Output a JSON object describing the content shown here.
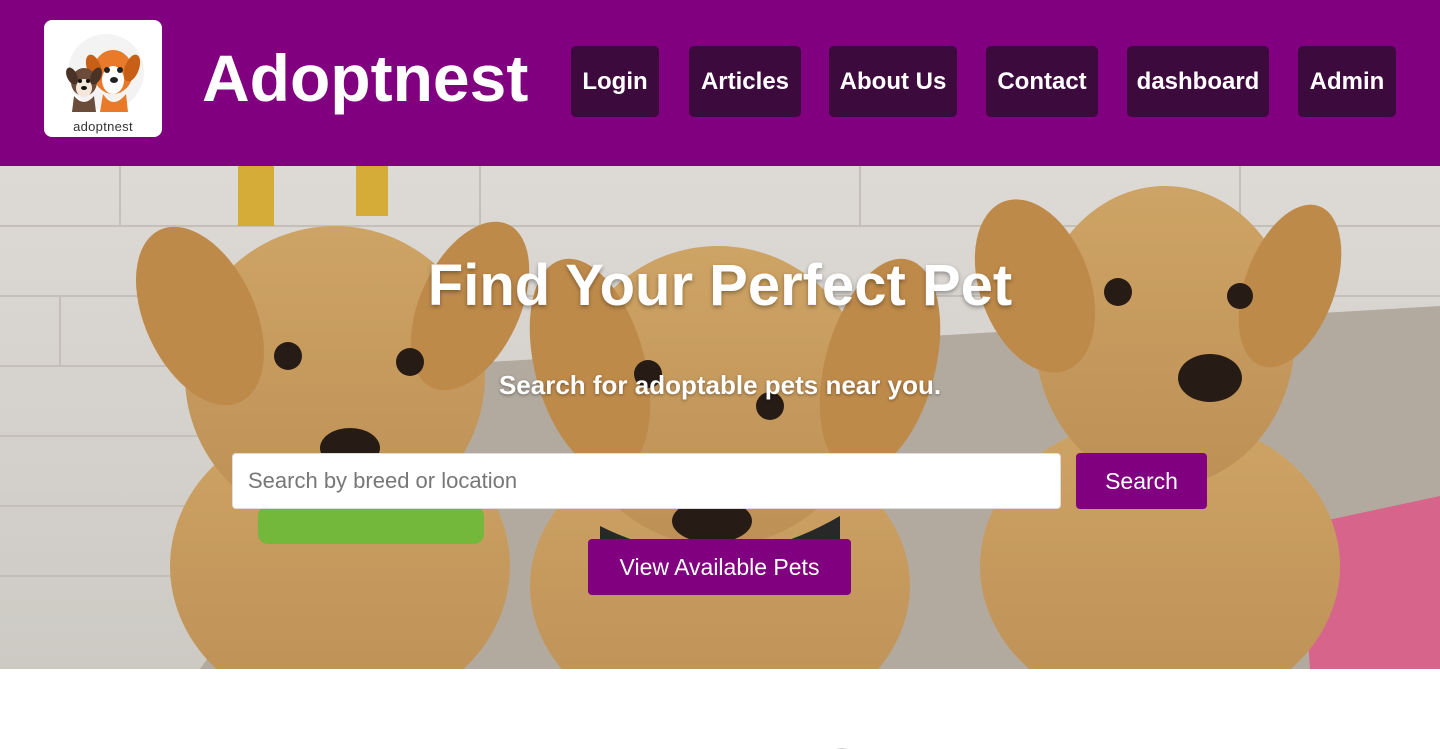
{
  "header": {
    "logo_text": "adoptnest",
    "brand": "Adoptnest",
    "nav": [
      {
        "label": "Login"
      },
      {
        "label": "Articles"
      },
      {
        "label": "About Us"
      },
      {
        "label": "Contact"
      },
      {
        "label": "dashboard"
      },
      {
        "label": "Admin"
      }
    ]
  },
  "hero": {
    "title": "Find Your Perfect Pet",
    "subtitle": "Search for adoptable pets near you.",
    "search": {
      "placeholder": "Search by breed or location",
      "value": "",
      "button_label": "Search"
    },
    "cta_label": "View Available Pets"
  },
  "colors": {
    "brand_purple": "#800080",
    "nav_button": "#3d0a3d",
    "text_on_dark": "#ffffff"
  },
  "icons": [
    "logo-dogs-icon"
  ]
}
